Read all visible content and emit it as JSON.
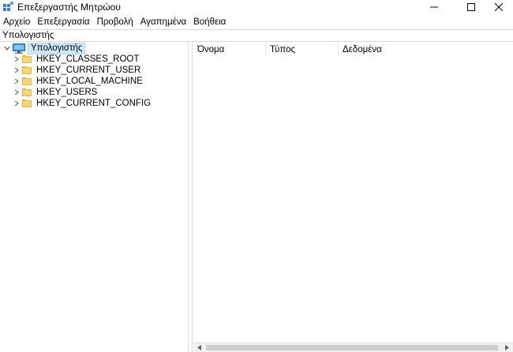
{
  "window": {
    "title": "Επεξεργαστής Μητρώου",
    "minimize_icon": "minimize-icon",
    "maximize_icon": "maximize-icon",
    "close_icon": "close-icon"
  },
  "menu": {
    "items": [
      "Αρχείο",
      "Επεξεργασία",
      "Προβολή",
      "Αγαπημένα",
      "Βοήθεια"
    ]
  },
  "address": {
    "path": "Υπολογιστής"
  },
  "tree": {
    "root_label": "Υπολογιστής",
    "root_icon": "computer-icon",
    "keys": [
      "HKEY_CLASSES_ROOT",
      "HKEY_CURRENT_USER",
      "HKEY_LOCAL_MACHINE",
      "HKEY_USERS",
      "HKEY_CURRENT_CONFIG"
    ]
  },
  "list": {
    "columns": [
      "Όνομα",
      "Τύπος",
      "Δεδομένα"
    ]
  },
  "colors": {
    "selection": "#cce8ff",
    "folder": "#f7d676",
    "border": "#d9d9d9"
  }
}
